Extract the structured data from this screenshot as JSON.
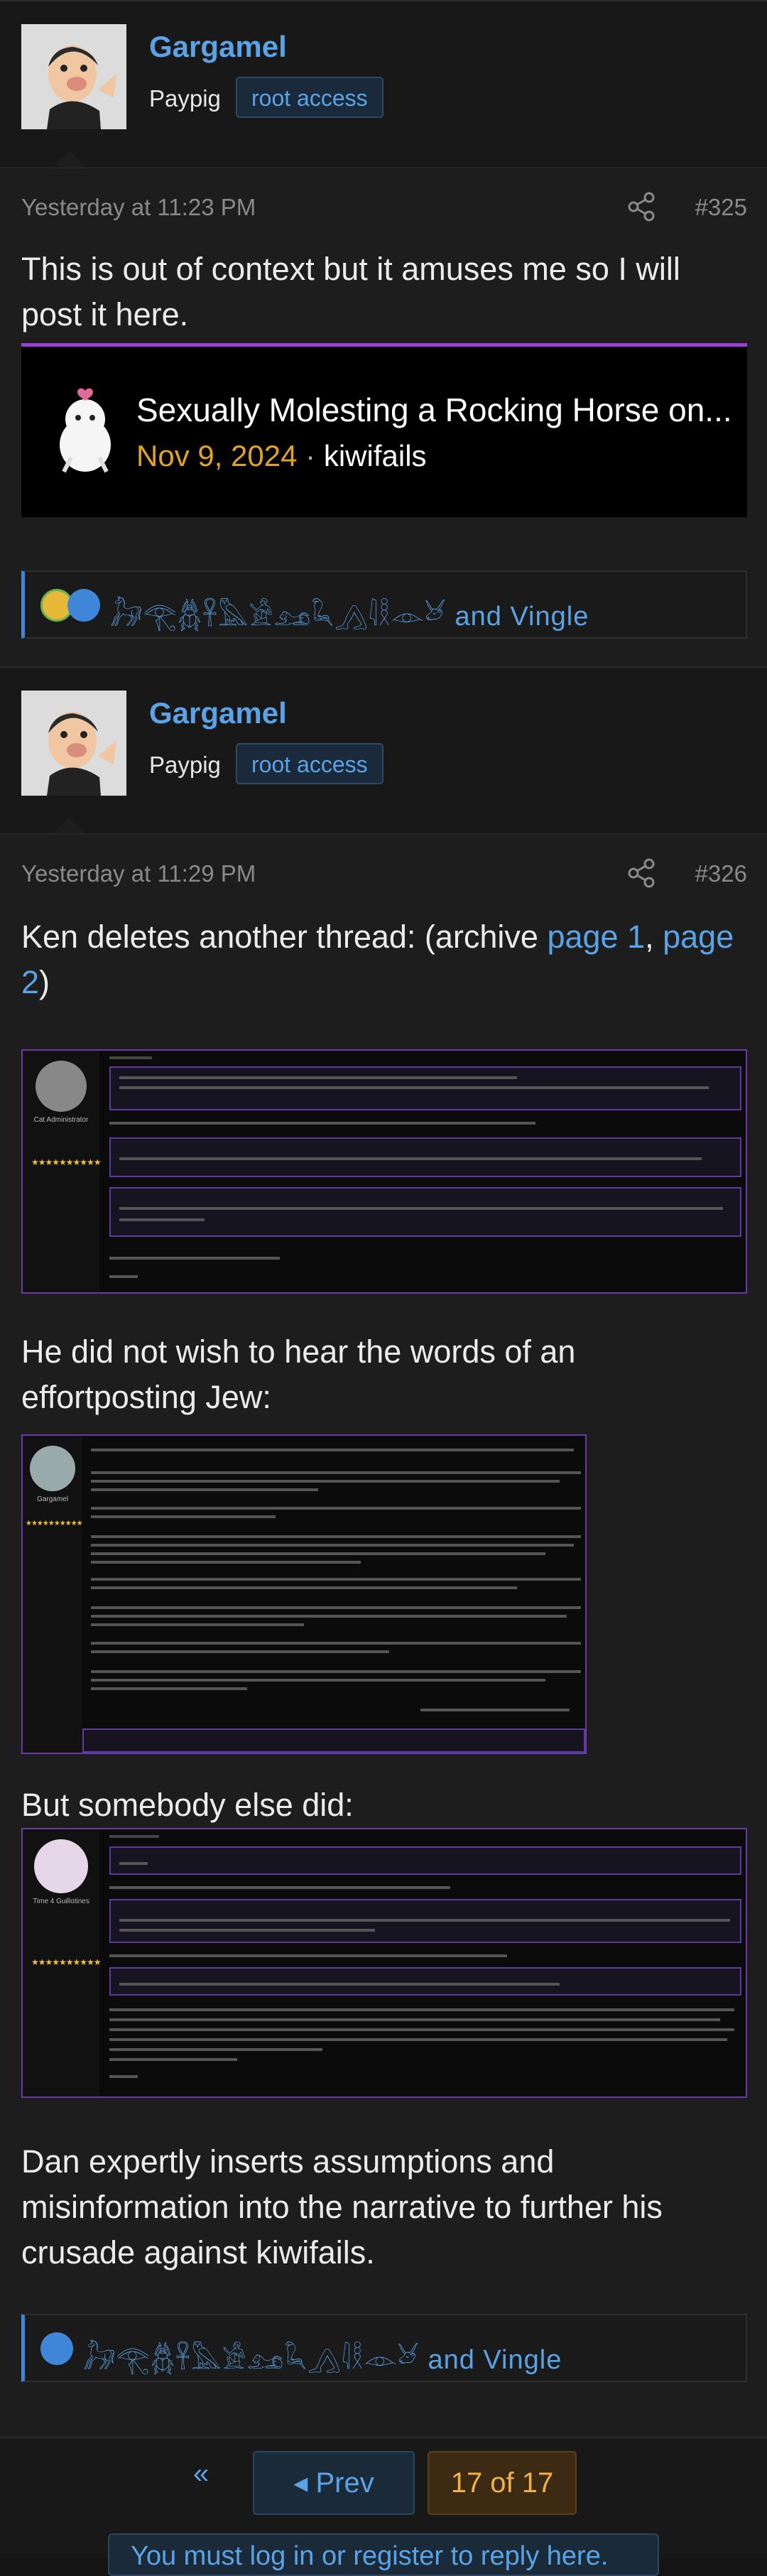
{
  "posts": [
    {
      "author": "Gargamel",
      "user_title": "Paypig",
      "badge": "root access",
      "timestamp": "Yesterday at 11:23 PM",
      "number": "#325",
      "text": "This is out of context but it amuses me so I will post it here.",
      "embed": {
        "title": "Sexually Molesting a Rocking Horse on...",
        "date": "Nov 9, 2024",
        "separator": "·",
        "site": "kiwifails"
      },
      "reactions": {
        "runes": "𓃗𓂀𓆣𓋹𓅓𓀀𓃭𓆗𓂻𓇋𓎛𓁹𓃾",
        "suffix": "and Vingle"
      }
    },
    {
      "author": "Gargamel",
      "user_title": "Paypig",
      "badge": "root access",
      "timestamp": "Yesterday at 11:29 PM",
      "number": "#326",
      "intro_text": "Ken deletes another thread: (archive ",
      "link1": "page 1",
      "comma": ", ",
      "link2": "page 2",
      "close": ")",
      "paragraph2": "He did not wish to hear the words of an effortposting Jew:",
      "paragraph3": "But somebody else did:",
      "paragraph4": "Dan expertly inserts assumptions and misinformation into the narrative to further his crusade against kiwifails.",
      "shot1": {
        "role": "Cat Administrator",
        "stars": "★★★★★★★★★★"
      },
      "shot2": {
        "role": "Gargamel",
        "stars": "★★★★★★★★★★"
      },
      "shot3": {
        "role": "Time 4 Guillotines",
        "stars": "★★★★★★★★★★"
      },
      "reactions": {
        "runes": "𓃗𓂀𓆣𓋹𓅓𓀀𓃭𓆗𓂻𓇋𓎛𓁹𓃾",
        "suffix": "and Vingle"
      }
    }
  ],
  "pagination": {
    "first_icon": "«",
    "prev_label": "◂  Prev",
    "current": "17 of 17"
  },
  "login_prompt": "You must log in or register to reply here.",
  "colors": {
    "accent": "#5aa3e6",
    "embed_border": "#9b3fd6",
    "date": "#e0a32a",
    "pager_current": "#f0b04a"
  }
}
